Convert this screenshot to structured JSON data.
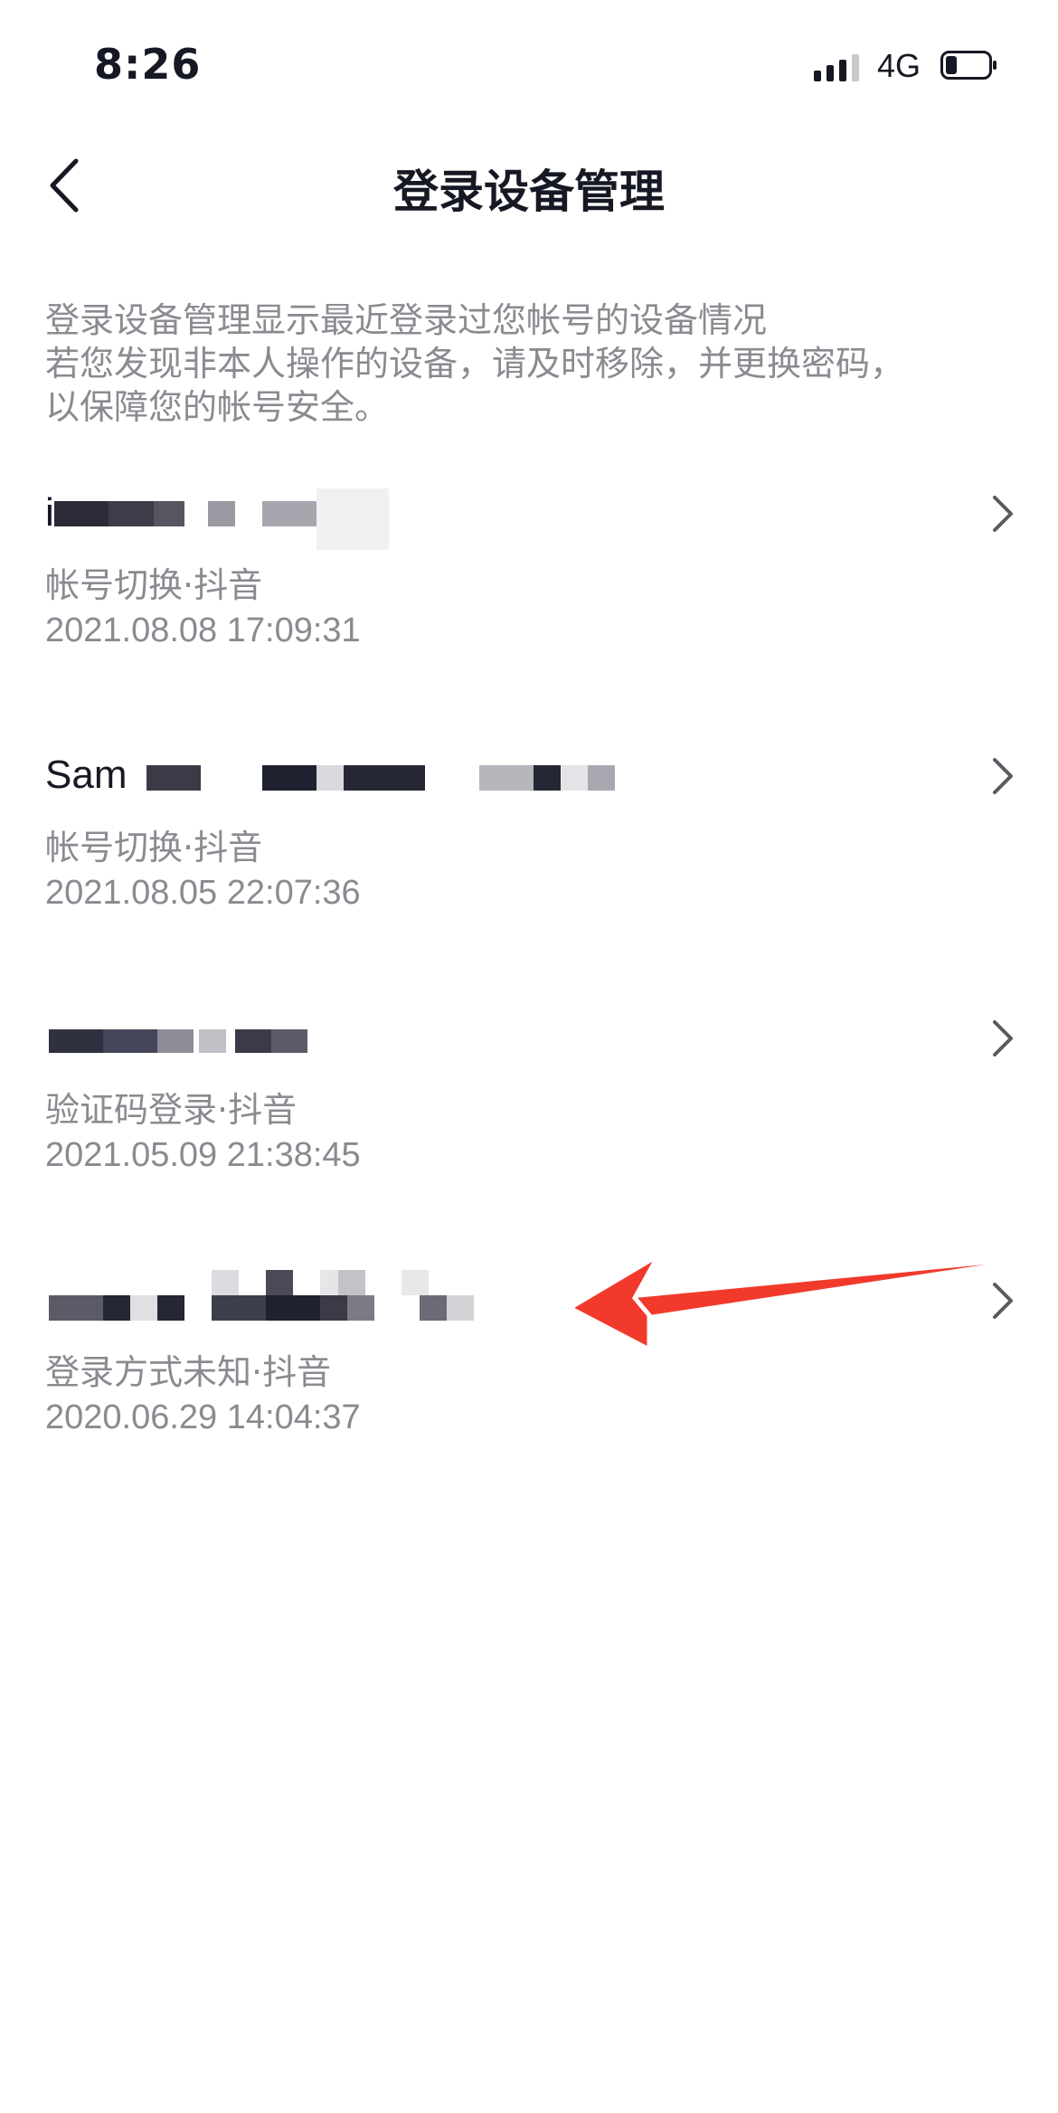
{
  "status_bar": {
    "time": "8:26",
    "network": "4G",
    "signal_icon": "signal-bars-icon",
    "battery_icon": "battery-icon"
  },
  "nav": {
    "back_icon": "chevron-left-icon",
    "title": "登录设备管理"
  },
  "description": {
    "lines": [
      "登录设备管理显示最近登录过您帐号的设备情况",
      "若您发现非本人操作的设备，请及时移除，并更换密码，",
      "以保障您的帐号安全。"
    ]
  },
  "devices": [
    {
      "name": "i",
      "method": "帐号切换·抖音",
      "time": "2021.08.08 17:09:31"
    },
    {
      "name": "Sam",
      "method": "帐号切换·抖音",
      "time": "2021.08.05 22:07:36"
    },
    {
      "name": "",
      "method": "验证码登录·抖音",
      "time": "2021.05.09 21:38:45"
    },
    {
      "name": "",
      "method": "登录方式未知·抖音",
      "time": "2020.06.29 14:04:37"
    }
  ],
  "colors": {
    "primary_text": "#161823",
    "secondary_text": "#8a8b91",
    "arrow": "#f23a2c"
  }
}
